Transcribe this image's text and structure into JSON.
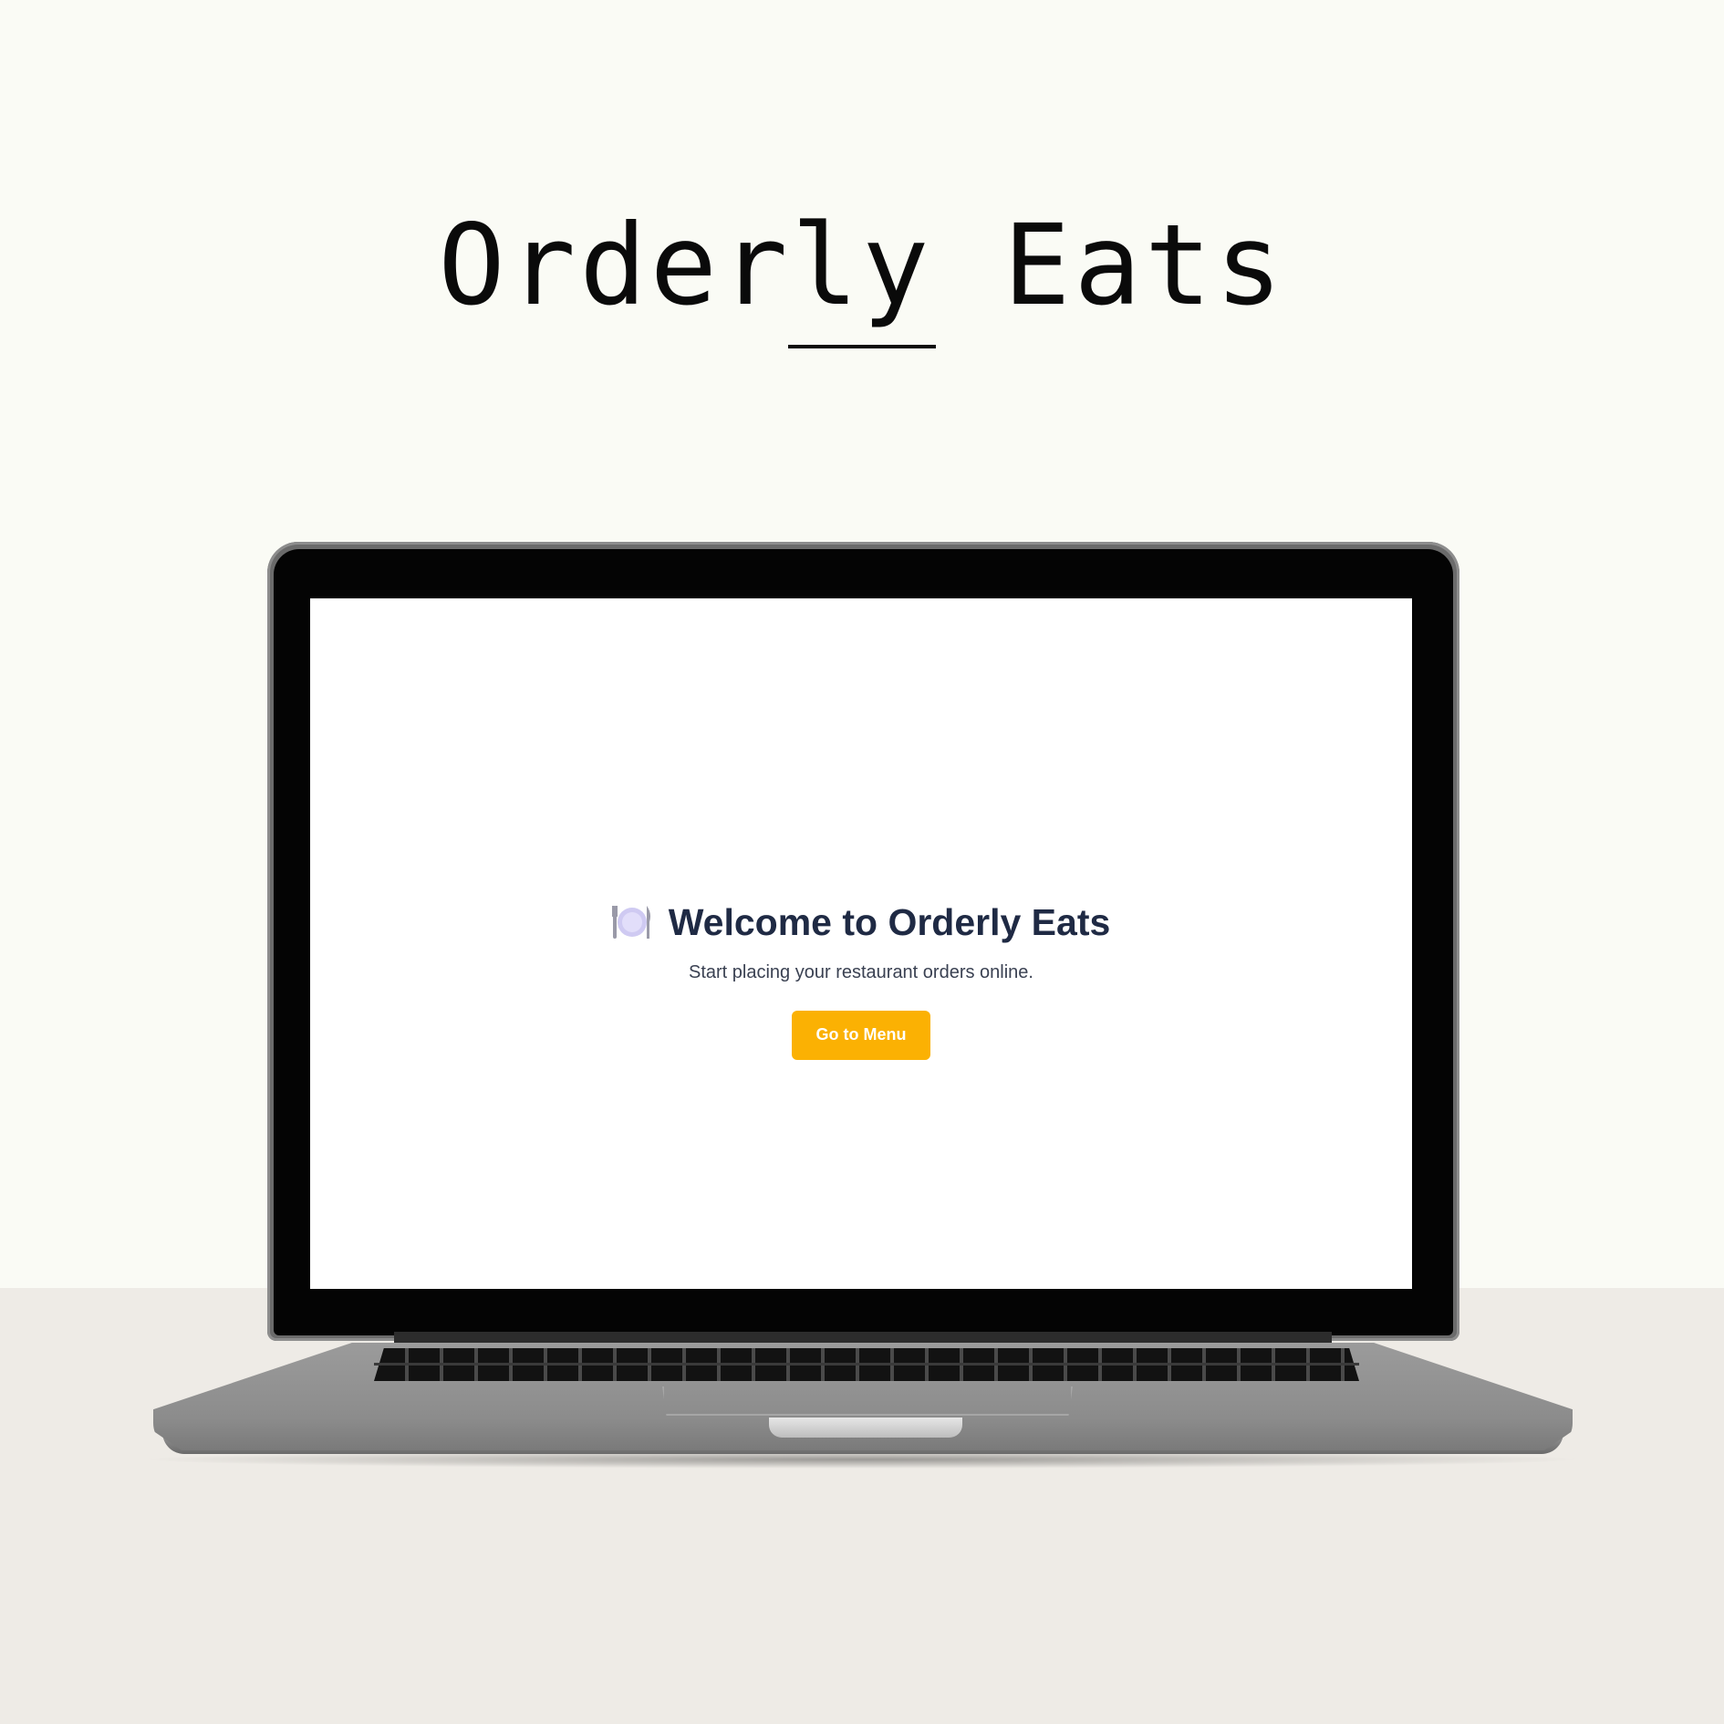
{
  "brand": {
    "name": "Orderly Eats"
  },
  "screen": {
    "icon": "plate-fork-knife-icon",
    "title": "Welcome to Orderly Eats",
    "subtitle": "Start placing your restaurant orders online.",
    "button_label": "Go to Menu"
  },
  "colors": {
    "background": "#fafbf5",
    "floor": "#eeebe6",
    "title": "#1f2a44",
    "button": "#fbb103",
    "button_text": "#ffffff"
  }
}
